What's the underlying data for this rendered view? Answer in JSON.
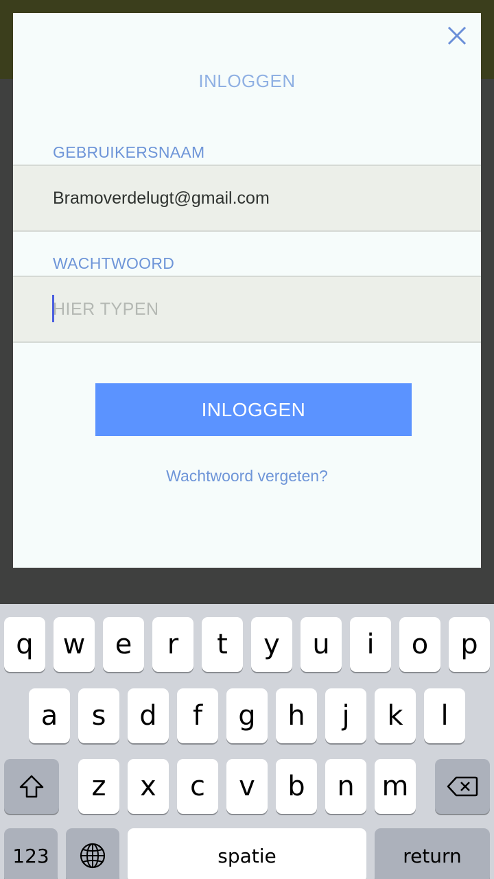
{
  "modal": {
    "title": "INLOGGEN",
    "username_label": "GEBRUIKERSNAAM",
    "username_value": "Bramoverdelugt@gmail.com",
    "password_label": "WACHTWOORD",
    "password_placeholder": "HIER TYPEN",
    "login_button": "INLOGGEN",
    "forgot_link": "Wachtwoord vergeten?",
    "close_icon": "close-icon"
  },
  "colors": {
    "accent": "#5b93ff",
    "label": "#6e95d8",
    "caret": "#4a5ee0"
  },
  "keyboard": {
    "row1": [
      "q",
      "w",
      "e",
      "r",
      "t",
      "y",
      "u",
      "i",
      "o",
      "p"
    ],
    "row2": [
      "a",
      "s",
      "d",
      "f",
      "g",
      "h",
      "j",
      "k",
      "l"
    ],
    "row3": [
      "z",
      "x",
      "c",
      "v",
      "b",
      "n",
      "m"
    ],
    "shift_icon": "shift-icon",
    "backspace_icon": "backspace-icon",
    "numbers_label": "123",
    "globe_icon": "globe-icon",
    "space_label": "spatie",
    "return_label": "return"
  }
}
